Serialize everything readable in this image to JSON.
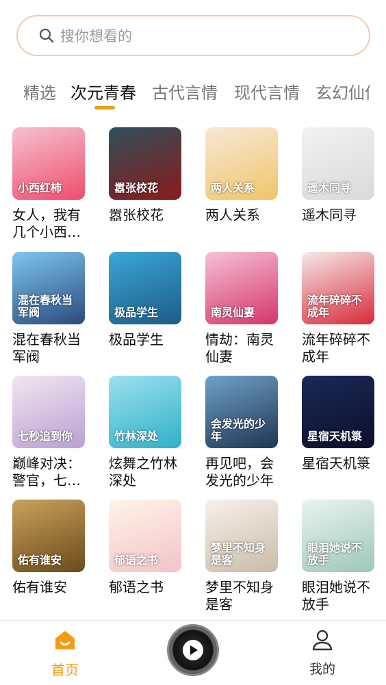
{
  "search": {
    "placeholder": "搜你想看的"
  },
  "tabs": [
    {
      "label": "精选",
      "active": false
    },
    {
      "label": "次元青春",
      "active": true
    },
    {
      "label": "古代言情",
      "active": false
    },
    {
      "label": "现代言情",
      "active": false
    },
    {
      "label": "玄幻仙侠",
      "active": false
    }
  ],
  "books": [
    {
      "title": "女人，我有几个小西…",
      "cover_text": "小西红柿",
      "cover_colors": [
        "#f5c1d0",
        "#ef4d6b"
      ]
    },
    {
      "title": "嚣张校花",
      "cover_text": "嚣张校花",
      "cover_colors": [
        "#2f4f5a",
        "#8b1b1b"
      ]
    },
    {
      "title": "两人关系",
      "cover_text": "两人关系",
      "cover_colors": [
        "#f7e8d6",
        "#f0c56a"
      ]
    },
    {
      "title": "遥木同寻",
      "cover_text": "遥木同寻",
      "cover_colors": [
        "#f2f2f2",
        "#d9d9d9"
      ]
    },
    {
      "title": "混在春秋当军阀",
      "cover_text": "混在春秋当军阀",
      "cover_colors": [
        "#7ec6ef",
        "#2a4b7c"
      ]
    },
    {
      "title": "极品学生",
      "cover_text": "极品学生",
      "cover_colors": [
        "#3aa7d8",
        "#1d5c86"
      ]
    },
    {
      "title": "情劫：南灵仙妻",
      "cover_text": "南灵仙妻",
      "cover_colors": [
        "#f4c1d6",
        "#d6356a"
      ]
    },
    {
      "title": "流年碎碎不成年",
      "cover_text": "流年碎碎不成年",
      "cover_colors": [
        "#f4eaea",
        "#d92a3a"
      ]
    },
    {
      "title": "巅峰对决：警官，七…",
      "cover_text": "七秒追到你",
      "cover_colors": [
        "#f3e5f0",
        "#b9a0d3"
      ]
    },
    {
      "title": "炫舞之竹林深处",
      "cover_text": "竹林深处",
      "cover_colors": [
        "#9be0ef",
        "#2fb1c7"
      ]
    },
    {
      "title": "再见吧，会发光的少年",
      "cover_text": "会发光的少年",
      "cover_colors": [
        "#6fa2c8",
        "#1f3553"
      ]
    },
    {
      "title": "星宿天机箓",
      "cover_text": "星宿天机箓",
      "cover_colors": [
        "#1a2a55",
        "#0b0f2b"
      ]
    },
    {
      "title": "佑有谁安",
      "cover_text": "佑有谁安",
      "cover_colors": [
        "#c9a25a",
        "#6b4a1d"
      ]
    },
    {
      "title": "郁语之书",
      "cover_text": "郁语之书",
      "cover_colors": [
        "#fff4e8",
        "#f2c3c8"
      ]
    },
    {
      "title": "梦里不知身是客",
      "cover_text": "梦里不知身是客",
      "cover_colors": [
        "#f7f1ea",
        "#c9bba9"
      ]
    },
    {
      "title": "眼泪她说不放手",
      "cover_text": "眼泪她说不放手",
      "cover_colors": [
        "#e8f4f0",
        "#9ec7b7"
      ]
    }
  ],
  "bottom_nav": {
    "home_label": "首页",
    "mine_label": "我的",
    "accent_color": "#f39c12"
  }
}
